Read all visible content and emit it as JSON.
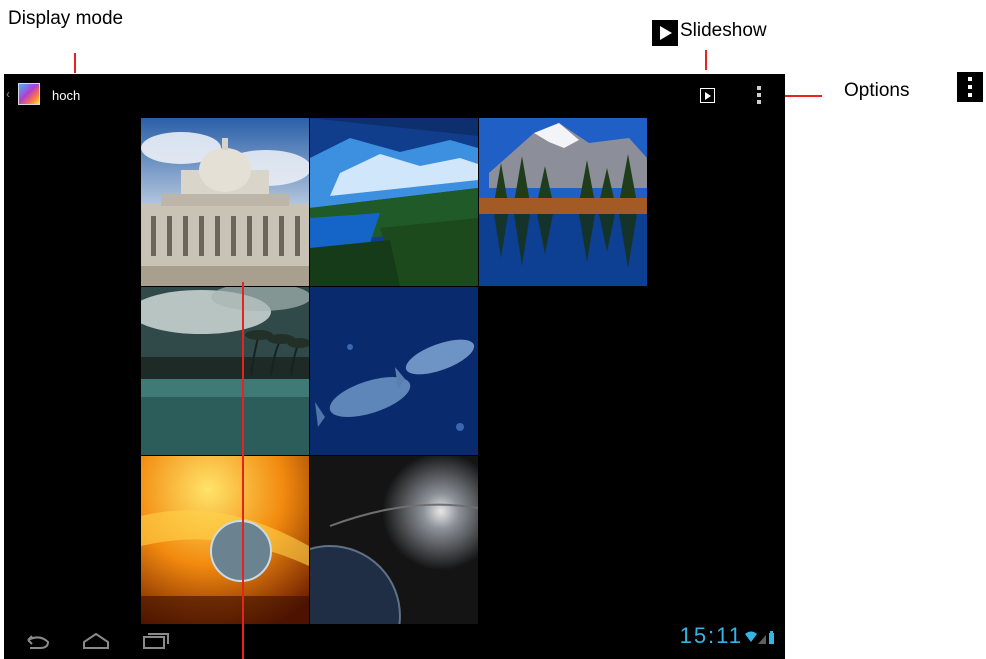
{
  "annotations": {
    "display_mode": "Display mode",
    "slideshow": "Slideshow",
    "options": "Options"
  },
  "action_bar": {
    "album_title": "hoch",
    "slideshow_icon": "slideshow-icon",
    "overflow_icon": "overflow-menu-icon"
  },
  "gallery": {
    "photos": [
      {
        "subject": "capitol-building"
      },
      {
        "subject": "glacier-lake"
      },
      {
        "subject": "mountain-lake-reflection"
      },
      {
        "subject": "tropical-beach"
      },
      {
        "subject": "underwater-fish"
      },
      {
        "subject": "sun-surface-planet"
      },
      {
        "subject": "space-planet"
      }
    ]
  },
  "nav_bar": {
    "back_icon": "back-icon",
    "home_icon": "home-icon",
    "recent_apps_icon": "recent-apps-icon",
    "clock": "15:11"
  },
  "colors": {
    "callout_line": "#e8231f",
    "clock": "#33b5e5",
    "screen_bg": "#000000"
  }
}
